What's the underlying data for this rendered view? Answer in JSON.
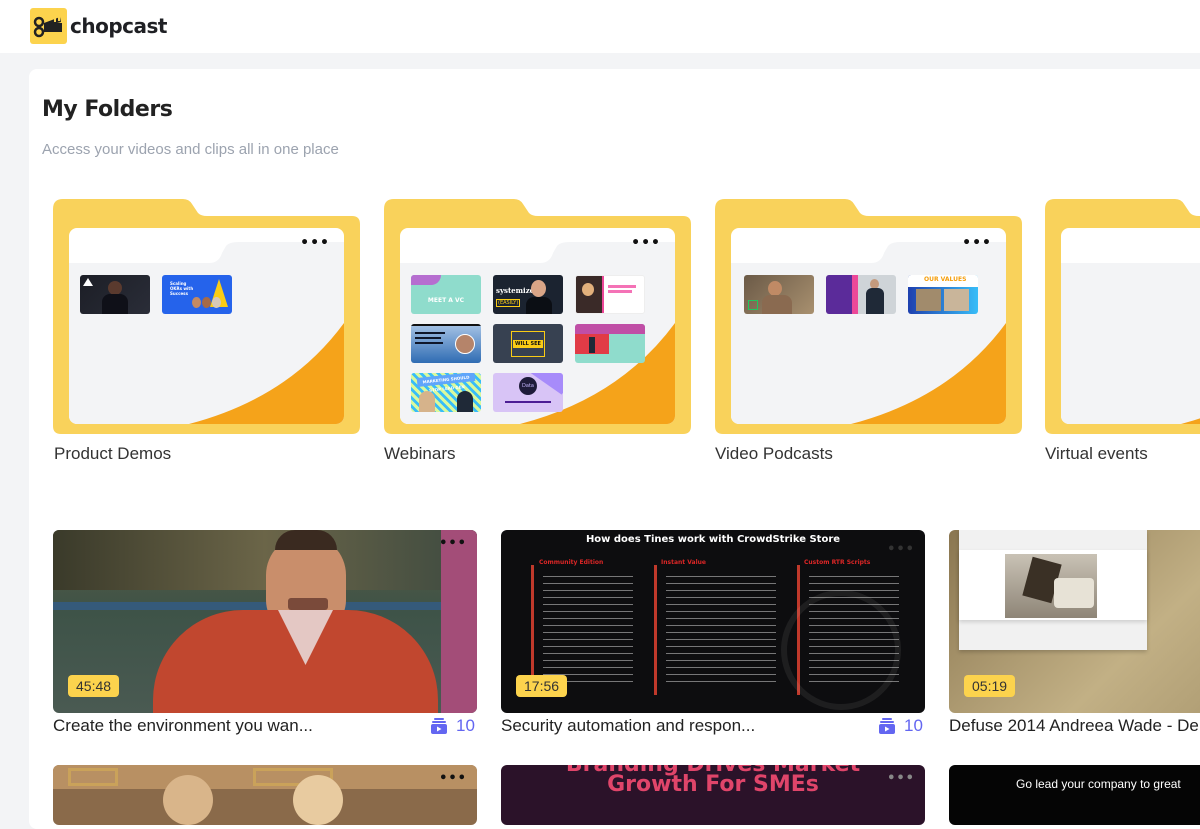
{
  "app": {
    "name": "chopcast"
  },
  "header": {
    "title": "My Folders",
    "subtitle": "Access your videos and clips all in one place"
  },
  "folders": [
    {
      "name": "Product Demos",
      "thumb_count": 2,
      "menu_icon": "more-horizontal-icon"
    },
    {
      "name": "Webinars",
      "thumb_count": 8,
      "menu_icon": "more-horizontal-icon"
    },
    {
      "name": "Video Podcasts",
      "thumb_count": 3,
      "menu_icon": "more-horizontal-icon"
    },
    {
      "name": "Virtual events",
      "thumb_count": 0,
      "menu_icon": "more-horizontal-icon"
    }
  ],
  "folder_thumb_text": {
    "webinar_meet": "MEET A VC",
    "webinar_systemize": "systemize",
    "webinar_easily": "(EASILY)",
    "webinar_price": "WILL SEE",
    "webinar_stop": "MARKETING SHOULD STOP LEAD GEN",
    "webinar_data": "Data",
    "podcast_values": "OUR VALUES",
    "demo_okr": "Scaling OKRs with Success"
  },
  "videos": [
    {
      "title": "Create the environment you wan...",
      "duration": "45:48",
      "clips": "10"
    },
    {
      "title": "Security automation and respon...",
      "duration": "17:56",
      "clips": "10",
      "slide_title": "How does Tines work with CrowdStrike Store",
      "slide_cols": [
        "Community Edition",
        "Instant Value",
        "Custom RTR Scripts"
      ]
    },
    {
      "title": "Defuse 2014 Andreea Wade - De",
      "duration": "05:19"
    }
  ],
  "videos_row2": [
    {
      "overlay": ""
    },
    {
      "overlay_line1": "Branding Drives Market",
      "overlay_line2": "Growth For SMEs"
    },
    {
      "overlay": "Go lead your company to great"
    }
  ],
  "colors": {
    "folder_yellow": "#f9d25b",
    "folder_orange": "#f5a31a",
    "duration_badge": "#fcd34d",
    "clip_accent": "#6366f1"
  }
}
